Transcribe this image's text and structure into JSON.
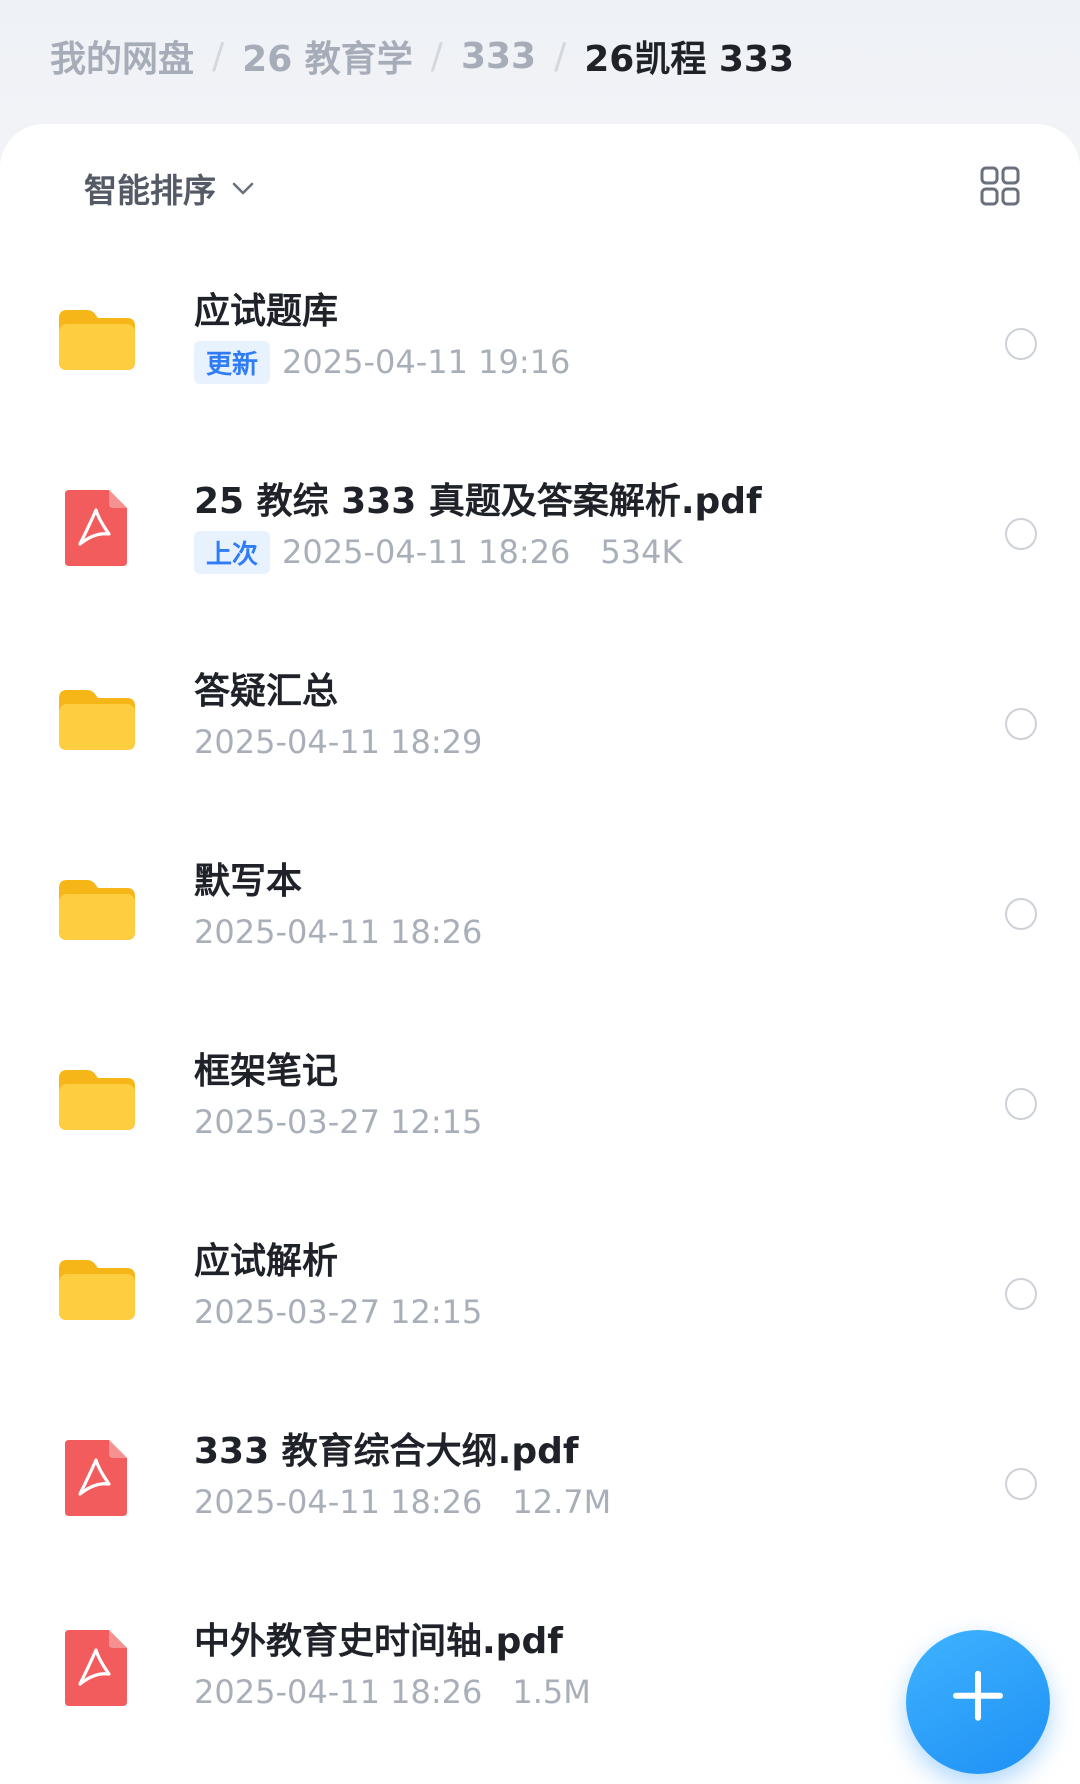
{
  "breadcrumb": {
    "items": [
      "我的网盘",
      "26 教育学",
      "333"
    ],
    "current": "26凯程 333",
    "separator": "/"
  },
  "toolbar": {
    "sort_label": "智能排序",
    "sort_icon": "chevron-down-icon",
    "view_toggle_icon": "grid-view-icon"
  },
  "files": [
    {
      "type": "folder",
      "icon": "folder-icon",
      "name": "应试题库",
      "tag": "更新",
      "date": "2025-04-11 19:16",
      "size": ""
    },
    {
      "type": "pdf",
      "icon": "pdf-icon",
      "name": "25 教综 333 真题及答案解析.pdf",
      "tag": "上次",
      "date": "2025-04-11 18:26",
      "size": "534K"
    },
    {
      "type": "folder",
      "icon": "folder-icon",
      "name": "答疑汇总",
      "tag": "",
      "date": "2025-04-11 18:29",
      "size": ""
    },
    {
      "type": "folder",
      "icon": "folder-icon",
      "name": "默写本",
      "tag": "",
      "date": "2025-04-11 18:26",
      "size": ""
    },
    {
      "type": "folder",
      "icon": "folder-icon",
      "name": "框架笔记",
      "tag": "",
      "date": "2025-03-27 12:15",
      "size": ""
    },
    {
      "type": "folder",
      "icon": "folder-icon",
      "name": "应试解析",
      "tag": "",
      "date": "2025-03-27 12:15",
      "size": ""
    },
    {
      "type": "pdf",
      "icon": "pdf-icon",
      "name": "333 教育综合大纲.pdf",
      "tag": "",
      "date": "2025-04-11 18:26",
      "size": "12.7M"
    },
    {
      "type": "pdf",
      "icon": "pdf-icon",
      "name": "中外教育史时间轴.pdf",
      "tag": "",
      "date": "2025-04-11 18:26",
      "size": "1.5M"
    }
  ],
  "fab": {
    "icon": "plus-icon"
  },
  "colors": {
    "accent": "#2f7df6",
    "folder": "#ffc93c",
    "pdf": "#f25c5c"
  }
}
